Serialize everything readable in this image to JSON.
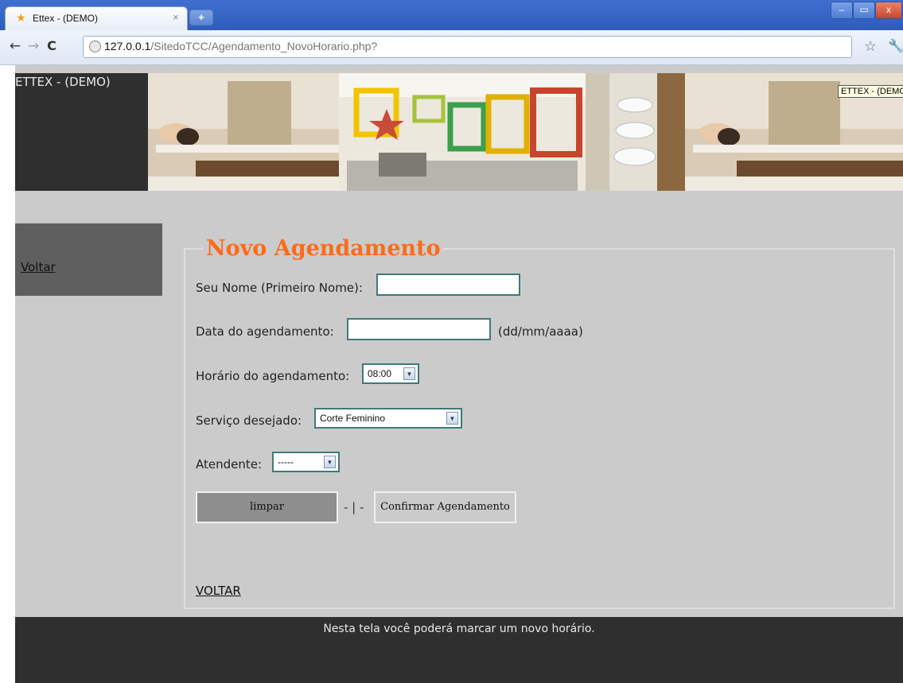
{
  "browser": {
    "tab_title": "Ettex - (DEMO)",
    "tab_close": "×",
    "new_tab": "+",
    "url_host": "127.0.0.1",
    "url_path": "/SitedoTCC/Agendamento_NovoHorario.php?",
    "window_controls": {
      "minimize": "–",
      "maximize": "▭",
      "close": "x"
    }
  },
  "header": {
    "brand": "ETTEX - (DEMO)",
    "tooltip": "ETTEX - (DEMO"
  },
  "sidebar": {
    "voltar": "Voltar"
  },
  "form": {
    "title": "Novo Agendamento",
    "nome_label": "Seu Nome (Primeiro Nome):",
    "nome_value": "",
    "data_label": "Data do agendamento:",
    "data_value": "",
    "data_hint": "(dd/mm/aaaa)",
    "horario_label": "Horário do agendamento:",
    "horario_value": "08:00",
    "servico_label": "Serviço desejado:",
    "servico_value": "Corte Feminino",
    "atendente_label": "Atendente:",
    "atendente_value": "-----",
    "limpar": "limpar",
    "separator": "- | -",
    "confirmar": "Confirmar Agendamento",
    "voltar": "VOLTAR"
  },
  "footer": {
    "text": "Nesta tela você poderá marcar um novo horário."
  },
  "colors": {
    "accent_title": "#ff6a1a",
    "header_dark": "#2f2f2f",
    "page_gray": "#cbcbcb",
    "input_border": "#3f7a78"
  }
}
